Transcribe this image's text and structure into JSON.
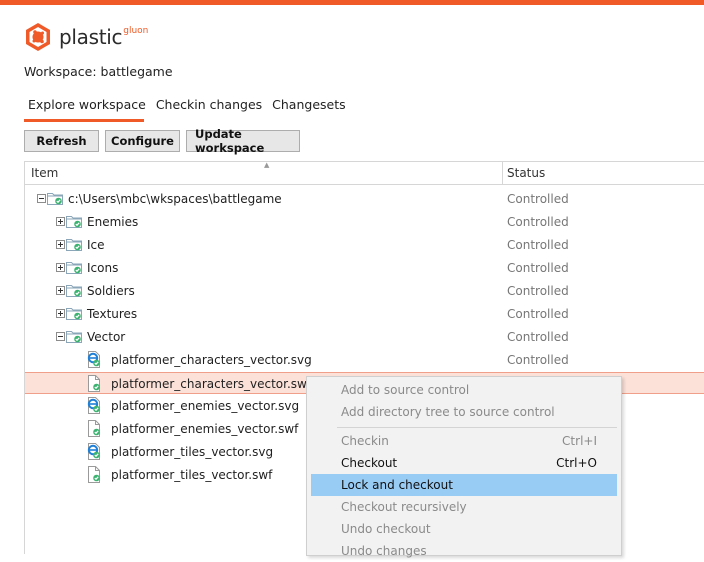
{
  "app": {
    "logo_text": "plastic",
    "logo_sub": "gluon",
    "brand_color": "#f05a28"
  },
  "workspace_label": "Workspace: battlegame",
  "tabs": [
    {
      "label": "Explore workspace",
      "active": true
    },
    {
      "label": "Checkin changes",
      "active": false
    },
    {
      "label": "Changesets",
      "active": false
    }
  ],
  "toolbar": {
    "refresh": "Refresh",
    "configure": "Configure",
    "update": "Update workspace"
  },
  "columns": {
    "item": "Item",
    "status": "Status"
  },
  "rows": [
    {
      "label": "c:\\Users\\mbc\\wkspaces\\battlegame",
      "status": "Controlled",
      "kind": "folder",
      "expander": "minus"
    },
    {
      "label": "Enemies",
      "status": "Controlled",
      "kind": "folder",
      "expander": "plus"
    },
    {
      "label": "Ice",
      "status": "Controlled",
      "kind": "folder",
      "expander": "plus"
    },
    {
      "label": "Icons",
      "status": "Controlled",
      "kind": "folder",
      "expander": "plus"
    },
    {
      "label": "Soldiers",
      "status": "Controlled",
      "kind": "folder",
      "expander": "plus"
    },
    {
      "label": "Textures",
      "status": "Controlled",
      "kind": "folder",
      "expander": "plus"
    },
    {
      "label": "Vector",
      "status": "Controlled",
      "kind": "folder",
      "expander": "minus"
    },
    {
      "label": "platformer_characters_vector.svg",
      "status": "Controlled",
      "kind": "svg-file"
    },
    {
      "label": "platformer_characters_vector.swf",
      "status": "",
      "kind": "file",
      "selected": true
    },
    {
      "label": "platformer_enemies_vector.svg",
      "status": "",
      "kind": "svg-file"
    },
    {
      "label": "platformer_enemies_vector.swf",
      "status": "",
      "kind": "file"
    },
    {
      "label": "platformer_tiles_vector.svg",
      "status": "",
      "kind": "svg-file"
    },
    {
      "label": "platformer_tiles_vector.swf",
      "status": "",
      "kind": "file"
    }
  ],
  "context_menu": {
    "add_to_source_control": "Add to source control",
    "add_directory_tree": "Add directory tree to source control",
    "checkin": "Checkin",
    "checkin_shortcut": "Ctrl+I",
    "checkout": "Checkout",
    "checkout_shortcut": "Ctrl+O",
    "lock_and_checkout": "Lock and checkout",
    "checkout_recursively": "Checkout recursively",
    "undo_checkout": "Undo checkout",
    "undo_changes": "Undo changes"
  }
}
